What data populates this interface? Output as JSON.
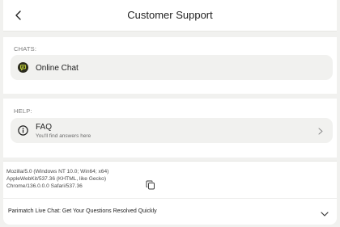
{
  "header": {
    "title": "Customer Support"
  },
  "chats": {
    "label": "CHATS:",
    "items": [
      {
        "label": "Online Chat",
        "icon": "chat-bubble-icon"
      }
    ]
  },
  "help": {
    "label": "HELP:",
    "items": [
      {
        "label": "FAQ",
        "sublabel": "You'll find answers here",
        "icon": "info-icon"
      }
    ]
  },
  "user_agent": {
    "lines": [
      "Mozilla/5.0 (Windows NT 10.0; Win64; x64)",
      "AppleWebKit/537.36 (KHTML, like Gecko)",
      "Chrome/136.0.0.0 Safari/537.36"
    ],
    "copy_icon": "copy-icon"
  },
  "footer": {
    "text": "Parimatch Live Chat: Get Your Questions Resolved Quickly",
    "icon": "chevron-down-icon"
  },
  "colors": {
    "background": "#f1f1ef",
    "panel": "#ffffff",
    "chat_icon_bg": "#2b2b1d",
    "chat_icon_fg": "#c7d93a"
  }
}
